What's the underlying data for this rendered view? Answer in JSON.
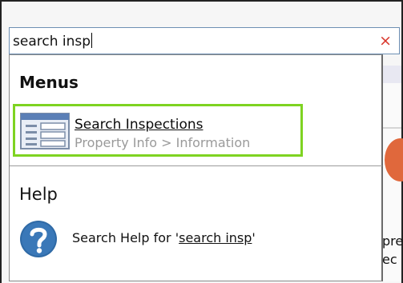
{
  "search": {
    "value": "search insp",
    "clear_icon": "×"
  },
  "menus_section": {
    "header": "Menus",
    "results": [
      {
        "icon": "menu-list-icon",
        "title": "Search Inspections",
        "path": "Property Info > Information"
      }
    ]
  },
  "help_section": {
    "header": "Help",
    "item_prefix": "Search Help for '",
    "item_query": "search insp",
    "item_suffix": "'",
    "icon": "help-question-icon"
  },
  "background": {
    "text_line1": "pre",
    "text_line2": "ec"
  },
  "colors": {
    "highlight_border": "#7ed321",
    "clear_icon": "#d9352a",
    "help_icon": "#2f6aa6",
    "accent_orange": "#e0683c"
  }
}
